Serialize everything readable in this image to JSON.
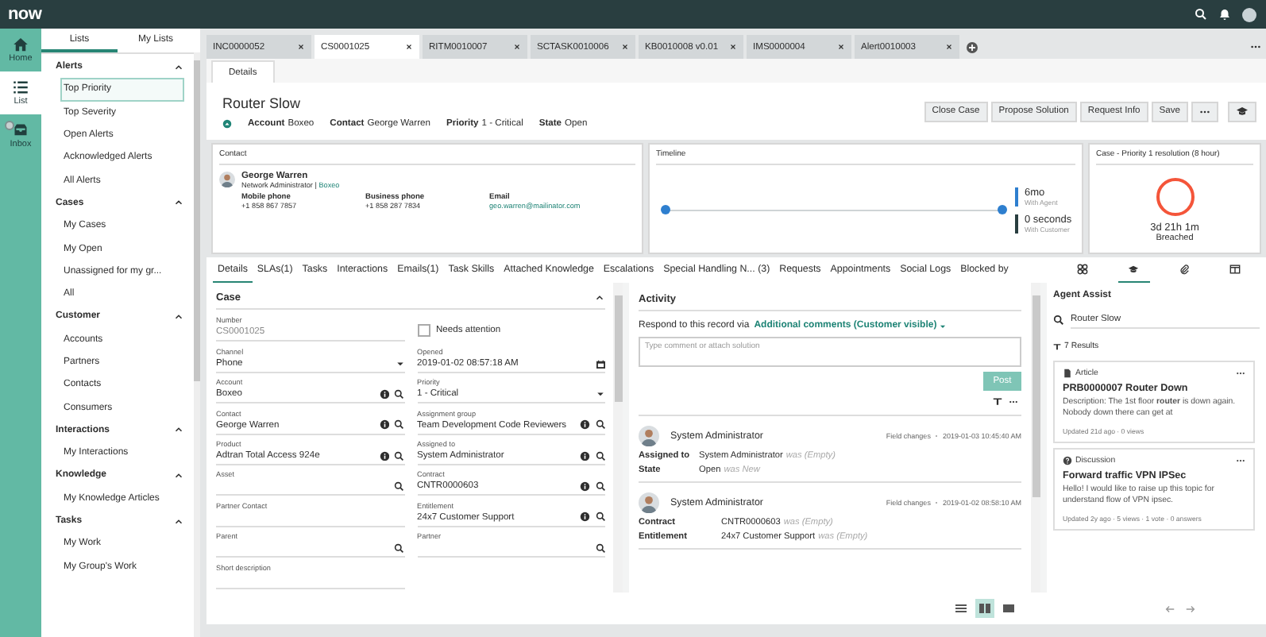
{
  "brand": "now",
  "nav": [
    {
      "label": "Home",
      "selected": false,
      "badge": false
    },
    {
      "label": "List",
      "selected": true,
      "badge": false
    },
    {
      "label": "Inbox",
      "selected": false,
      "badge": true
    }
  ],
  "lists_panel": {
    "tabs": [
      {
        "label": "Lists",
        "selected": true
      },
      {
        "label": "My Lists",
        "selected": false
      }
    ],
    "groups": [
      {
        "title": "Alerts",
        "expanded": true,
        "items": [
          {
            "label": "Top Priority",
            "selected": true
          },
          {
            "label": "Top Severity",
            "selected": false
          },
          {
            "label": "Open Alerts",
            "selected": false
          },
          {
            "label": "Acknowledged Alerts",
            "selected": false
          },
          {
            "label": "All Alerts",
            "selected": false
          }
        ]
      },
      {
        "title": "Cases",
        "expanded": true,
        "items": [
          {
            "label": "My Cases",
            "selected": false
          },
          {
            "label": "My Open",
            "selected": false
          },
          {
            "label": "Unassigned for my gr...",
            "selected": false
          },
          {
            "label": "All",
            "selected": false
          }
        ]
      },
      {
        "title": "Customer",
        "expanded": true,
        "items": [
          {
            "label": "Accounts",
            "selected": false
          },
          {
            "label": "Partners",
            "selected": false
          },
          {
            "label": "Contacts",
            "selected": false
          },
          {
            "label": "Consumers",
            "selected": false
          }
        ]
      },
      {
        "title": "Interactions",
        "expanded": true,
        "items": [
          {
            "label": "My Interactions",
            "selected": false
          }
        ]
      },
      {
        "title": "Knowledge",
        "expanded": true,
        "items": [
          {
            "label": "My Knowledge Articles",
            "selected": false
          }
        ]
      },
      {
        "title": "Tasks",
        "expanded": true,
        "items": [
          {
            "label": "My Work",
            "selected": false
          },
          {
            "label": "My Group's Work",
            "selected": false
          }
        ]
      }
    ]
  },
  "record_tabs": [
    {
      "label": "INC0000052",
      "selected": false
    },
    {
      "label": "CS0001025",
      "selected": true
    },
    {
      "label": "RITM0010007",
      "selected": false
    },
    {
      "label": "SCTASK0010006",
      "selected": false
    },
    {
      "label": "KB0010008 v0.01",
      "selected": false
    },
    {
      "label": "IMS0000004",
      "selected": false
    },
    {
      "label": "Alert0010003",
      "selected": false
    }
  ],
  "subtabs": [
    {
      "label": "Details",
      "selected": true
    }
  ],
  "header": {
    "title": "Router Slow",
    "fields": [
      {
        "label": "Account",
        "value": "Boxeo"
      },
      {
        "label": "Contact",
        "value": "George Warren"
      },
      {
        "label": "Priority",
        "value": "1 - Critical"
      },
      {
        "label": "State",
        "value": "Open"
      }
    ],
    "buttons": [
      "Close Case",
      "Propose Solution",
      "Request Info",
      "Save"
    ]
  },
  "contact_card": {
    "title": "Contact",
    "name": "George Warren",
    "role": "Network Administrator",
    "separator": "|",
    "company": "Boxeo",
    "details": [
      {
        "label": "Mobile phone",
        "value": "+1 858 867 7857",
        "kind": "text"
      },
      {
        "label": "Business phone",
        "value": "+1 858 287 7834",
        "kind": "text"
      },
      {
        "label": "Email",
        "value": "geo.warren@mailinator.com",
        "kind": "link"
      }
    ]
  },
  "timeline": {
    "title": "Timeline",
    "segments": [
      {
        "value": "6mo",
        "label": "With Agent",
        "color": "#2e7fcf"
      },
      {
        "value": "0 seconds",
        "label": "With Customer",
        "color": "#293e40"
      }
    ]
  },
  "sla": {
    "title": "Case - Priority 1 resolution (8 hour)",
    "time": "3d 21h 1m",
    "status": "Breached"
  },
  "form_tabs": [
    {
      "label": "Details",
      "selected": true
    },
    {
      "label": "SLAs(1)",
      "selected": false
    },
    {
      "label": "Tasks",
      "selected": false
    },
    {
      "label": "Interactions",
      "selected": false
    },
    {
      "label": "Emails(1)",
      "selected": false
    },
    {
      "label": "Task Skills",
      "selected": false
    },
    {
      "label": "Attached Knowledge",
      "selected": false
    },
    {
      "label": "Escalations",
      "selected": false
    },
    {
      "label": "Special Handling N... (3)",
      "selected": false
    },
    {
      "label": "Requests",
      "selected": false
    },
    {
      "label": "Appointments",
      "selected": false
    },
    {
      "label": "Social Logs",
      "selected": false
    },
    {
      "label": "Blocked by",
      "selected": false
    }
  ],
  "case_form": {
    "title": "Case",
    "expanded": true,
    "left": [
      {
        "label": "Number",
        "value": "CS0001025",
        "kind": "readonly"
      },
      {
        "label": "Channel",
        "value": "Phone",
        "kind": "select"
      },
      {
        "label": "Account",
        "value": "Boxeo",
        "kind": "reference"
      },
      {
        "label": "Contact",
        "value": "George Warren",
        "kind": "reference"
      },
      {
        "label": "Product",
        "value": "Adtran Total Access 924e",
        "kind": "reference"
      },
      {
        "label": "Asset",
        "kind": "lookup"
      },
      {
        "label": "Partner Contact",
        "kind": "text"
      },
      {
        "label": "Parent",
        "kind": "lookup"
      },
      {
        "label": "Short description",
        "kind": "text"
      }
    ],
    "right": [
      {
        "label": "Needs attention",
        "kind": "checkbox",
        "checked": false
      },
      {
        "label": "Opened",
        "value": "2019-01-02 08:57:18 AM",
        "kind": "date"
      },
      {
        "label": "Priority",
        "value": "1 - Critical",
        "kind": "select"
      },
      {
        "label": "Assignment group",
        "value": "Team Development Code Reviewers",
        "kind": "reference"
      },
      {
        "label": "Assigned to",
        "value": "System Administrator",
        "kind": "reference"
      },
      {
        "label": "Contract",
        "value": "CNTR0000603",
        "kind": "reference"
      },
      {
        "label": "Entitlement",
        "value": "24x7 Customer Support",
        "kind": "reference"
      },
      {
        "label": "Partner",
        "kind": "lookup"
      }
    ]
  },
  "activity": {
    "title": "Activity",
    "respond_text": "Respond to this record via",
    "journal": "Additional comments (Customer visible)",
    "placeholder": "Type comment or attach solution",
    "post_button": "Post",
    "entries": [
      {
        "author": "System Administrator",
        "type": "Field changes",
        "time": "2019-01-03 10:45:40 AM",
        "changes": [
          {
            "field": "Assigned to",
            "value": "System Administrator",
            "was": "was (Empty)"
          },
          {
            "field": "State",
            "value": "Open",
            "was": "was New"
          }
        ]
      },
      {
        "author": "System Administrator",
        "type": "Field changes",
        "time": "2019-01-02 08:58:10 AM",
        "changes": [
          {
            "field": "Contract",
            "value": "CNTR0000603",
            "was": "was (Empty)"
          },
          {
            "field": "Entitlement",
            "value": "24x7 Customer Support",
            "was": "was (Empty)"
          }
        ]
      }
    ]
  },
  "side_tabs": [
    {
      "selected": false
    },
    {
      "selected": true
    },
    {
      "selected": false
    },
    {
      "selected": false
    }
  ],
  "agent_assist": {
    "title": "Agent Assist",
    "search": "Router Slow",
    "results": "7 Results",
    "cards": [
      {
        "kind": "article",
        "type": "Article",
        "title": "PRB0000007 Router Down",
        "body": "Description: The 1st floor **router** is down again. Nobody down there can get at",
        "meta": "Updated 21d ago · 0 views"
      },
      {
        "kind": "discussion",
        "type": "Discussion",
        "title": "Forward traffic VPN IPSec",
        "body": "Hello! I would like to raise up this topic for understand flow of VPN ipsec.",
        "meta": "Updated 2y ago · 5 views · 1 vote · 0 answers"
      }
    ]
  },
  "view_modes": [
    {
      "selected": false
    },
    {
      "selected": true
    },
    {
      "selected": false
    }
  ]
}
